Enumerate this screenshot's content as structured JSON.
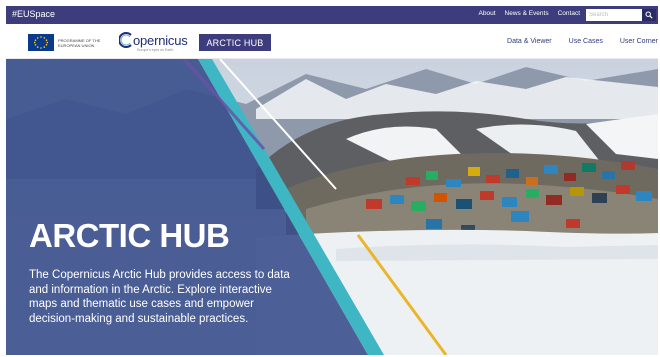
{
  "topbar": {
    "tag": "#EUSpace",
    "links": [
      "About",
      "News & Events",
      "Contact"
    ],
    "search_placeholder": "Search"
  },
  "header": {
    "eu_programme_text": "PROGRAMME OF THE EUROPEAN UNION",
    "copernicus_word": "opernicus",
    "copernicus_tagline": "Europe's eyes on Earth",
    "hub_tag": "ARCTIC HUB",
    "nav": [
      "Data & Viewer",
      "Use Cases",
      "User Corner"
    ]
  },
  "hero": {
    "title": "ARCTIC HUB",
    "description": "The Copernicus Arctic Hub provides access to data and information in the Arctic. Explore interactive maps and thematic use cases and empower decision-making and sustainable practices."
  },
  "colors": {
    "brand": "#3d3d7e",
    "overlay": "#3a4f8c",
    "teal_stripe": "#3fb6c4",
    "yellow_stripe": "#e9b52a"
  }
}
